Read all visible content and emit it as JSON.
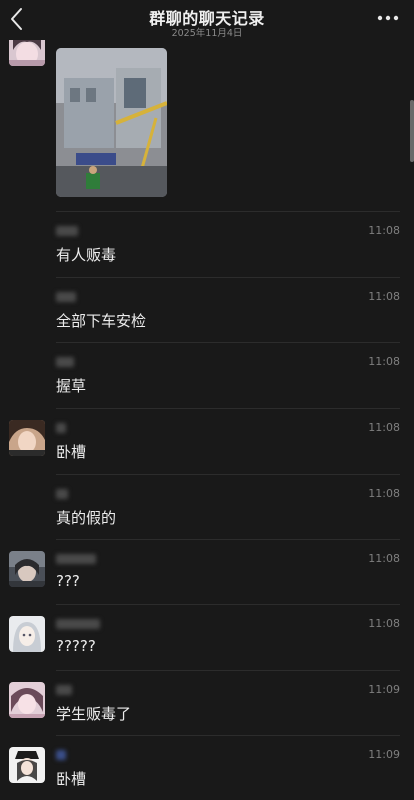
{
  "header": {
    "title": "群聊的聊天记录",
    "date": "2025年11月4日"
  },
  "messages": [
    {
      "time": "11:08",
      "text": "有人贩毒"
    },
    {
      "time": "11:08",
      "text": "全部下车安检"
    },
    {
      "time": "11:08",
      "text": "握草"
    },
    {
      "time": "11:08",
      "text": "卧槽"
    },
    {
      "time": "11:08",
      "text": "真的假的"
    },
    {
      "time": "11:08",
      "text": "???"
    },
    {
      "time": "11:08",
      "text": "?????"
    },
    {
      "time": "11:09",
      "text": "学生贩毒了"
    },
    {
      "time": "11:09",
      "text": "卧槽"
    }
  ],
  "icons": {
    "back": "chevron-left-icon",
    "more": "more-dots-icon"
  }
}
